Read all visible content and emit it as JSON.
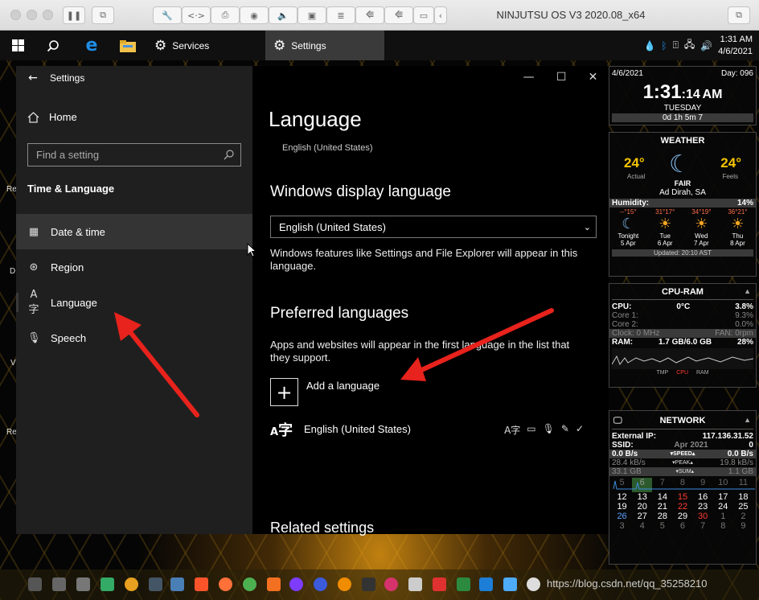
{
  "vm": {
    "title": "NINJUTSU OS V3 2020.08_x64",
    "icons": [
      "pause-icon",
      "snapshot-icon",
      "settings-wrench-icon",
      "code-icon",
      "printer-icon",
      "camera-icon",
      "sound-icon",
      "webcam-icon",
      "disk-icon",
      "usb-icon",
      "usb-icon",
      "folder-share-icon",
      "chevron-left-icon",
      "restore-icon"
    ]
  },
  "taskbar": {
    "apps": [
      {
        "label": "Services",
        "icon": "gear-icon"
      },
      {
        "label": "Settings",
        "icon": "gear-icon"
      }
    ],
    "clock": {
      "time": "1:31 AM",
      "date": "4/6/2021"
    }
  },
  "settings": {
    "window_title": "Settings",
    "home": "Home",
    "search_placeholder": "Find a setting",
    "section": "Time & Language",
    "nav": [
      {
        "label": "Date & time",
        "icon": "calendar-clock-icon"
      },
      {
        "label": "Region",
        "icon": "globe-icon"
      },
      {
        "label": "Language",
        "icon": "language-icon"
      },
      {
        "label": "Speech",
        "icon": "microphone-icon"
      }
    ],
    "content": {
      "title": "Language",
      "subtitle": "English (United States)",
      "display_heading": "Windows display language",
      "display_value": "English (United States)",
      "display_desc": "Windows features like Settings and File Explorer will appear in this language.",
      "preferred_heading": "Preferred languages",
      "preferred_desc": "Apps and websites will appear in the first language in the list that they support.",
      "add_language": "Add a language",
      "installed_language": "English (United States)",
      "related_heading": "Related settings"
    }
  },
  "widgets": {
    "clock": {
      "date": "4/6/2021",
      "day": "Day: 096",
      "time_main": "1:31",
      "time_sec": ":14",
      "ampm": "AM",
      "weekday": "TUESDAY",
      "uptime": "0d 1h 5m 7"
    },
    "weather": {
      "title": "WEATHER",
      "actual": "24°",
      "actual_label": "Actual",
      "feels": "24°",
      "feels_label": "Feels",
      "condition": "FAIR",
      "location": "Ad Dirah, SA",
      "humidity_label": "Humidity:",
      "humidity": "14%",
      "forecast": [
        {
          "temps": "--°15°",
          "day": "Tonight",
          "date": "5 Apr"
        },
        {
          "temps": "31°17°",
          "day": "Tue",
          "date": "6 Apr"
        },
        {
          "temps": "34°19°",
          "day": "Wed",
          "date": "7 Apr"
        },
        {
          "temps": "36°21°",
          "day": "Thu",
          "date": "8 Apr"
        }
      ],
      "updated": "Updated: 20:10 AST"
    },
    "cpu": {
      "title": "CPU-RAM",
      "cpu_label": "CPU:",
      "cpu_temp": "0°C",
      "cpu_pct": "3.8%",
      "core1_label": "Core 1:",
      "core1": "9.3%",
      "core2_label": "Core 2:",
      "core2": "0.0%",
      "clock_label": "Clock: 0 MHz",
      "fan": "FAN: 0rpm",
      "ram_label": "RAM:",
      "ram": "1.7 GB/6.0 GB",
      "ram_pct": "28%",
      "legend": [
        "TMP",
        "CPU",
        "RAM"
      ]
    },
    "network": {
      "title": "NETWORK",
      "ip_label": "External IP:",
      "ip": "117.136.31.52",
      "ssid_label": "SSID:",
      "ssid_month": "Apr 2021",
      "ssid": "0",
      "speed_down": "0.0 B/s",
      "speed_label": "▾SPEED▴",
      "speed_up": "0.0 B/s",
      "peak_down": "28.4 kB/s",
      "peak_label": "▾PEAK▴",
      "peak_up": "19.8 kB/s",
      "sum_down": "33.1 GB",
      "sum_label": "▾SUM▴",
      "sum_up": "1.1 GB"
    },
    "calendar": {
      "rows": [
        [
          "5",
          "6",
          "7",
          "8",
          "9",
          "10",
          "11"
        ],
        [
          "12",
          "13",
          "14",
          "15",
          "16",
          "17",
          "18"
        ],
        [
          "19",
          "20",
          "21",
          "22",
          "23",
          "24",
          "25"
        ],
        [
          "26",
          "27",
          "28",
          "29",
          "30",
          "1",
          "2"
        ],
        [
          "3",
          "4",
          "5",
          "6",
          "7",
          "8",
          "9"
        ]
      ]
    }
  },
  "desktop": {
    "edge_labels": [
      "Re",
      "D",
      "V",
      "Re"
    ]
  },
  "watermark": "https://blog.csdn.net/qq_35258210",
  "colors": {
    "accent_red": "#e8221c",
    "widget_yellow": "#f5c400",
    "cpu_red": "#ff3b30"
  }
}
